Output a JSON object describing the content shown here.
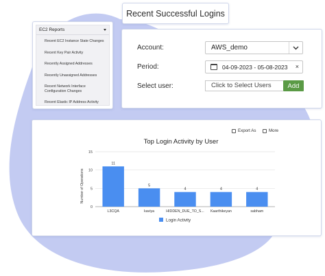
{
  "colors": {
    "accent_blue": "#4a8ef0",
    "blob": "#c3cbf2",
    "add_green": "#5a9a45"
  },
  "header": {
    "title": "Recent Successful Logins"
  },
  "reports_menu": {
    "title": "EC2 Reports",
    "items": [
      "Recent EC2 Instance State Changes",
      "Recent Key Pair Activity",
      "Recently Assigned Addresses",
      "Recently Unassigned Addresses",
      "Recent Network Interface Configuration Changes",
      "Recent Elastic IP Address Activity"
    ]
  },
  "filters": {
    "account_label": "Account:",
    "account_value": "AWS_demo",
    "period_label": "Period:",
    "period_value": "04-09-2023 - 05-08-2023",
    "period_clear": "×",
    "user_label": "Select user:",
    "user_placeholder": "Click to Select Users",
    "add_label": "Add"
  },
  "toolbar": {
    "export_label": "Export As",
    "more_label": "More"
  },
  "chart_data": {
    "type": "bar",
    "title": "Top Login Activity by User",
    "ylabel": "Number of Operations",
    "categories": [
      "L3CQA",
      "kaviya",
      "HIDDEN_DUE_TO_S...",
      "Kaarthikeyan",
      "sabham"
    ],
    "series": [
      {
        "name": "Login Activity",
        "values": [
          11,
          5,
          4,
          4,
          4
        ]
      }
    ],
    "ylim": [
      0,
      15
    ],
    "yticks": [
      0,
      5,
      10,
      15
    ],
    "data_labels": [
      "11",
      "5",
      "4",
      "4",
      "4"
    ],
    "legend": "bottom",
    "grid": true
  }
}
